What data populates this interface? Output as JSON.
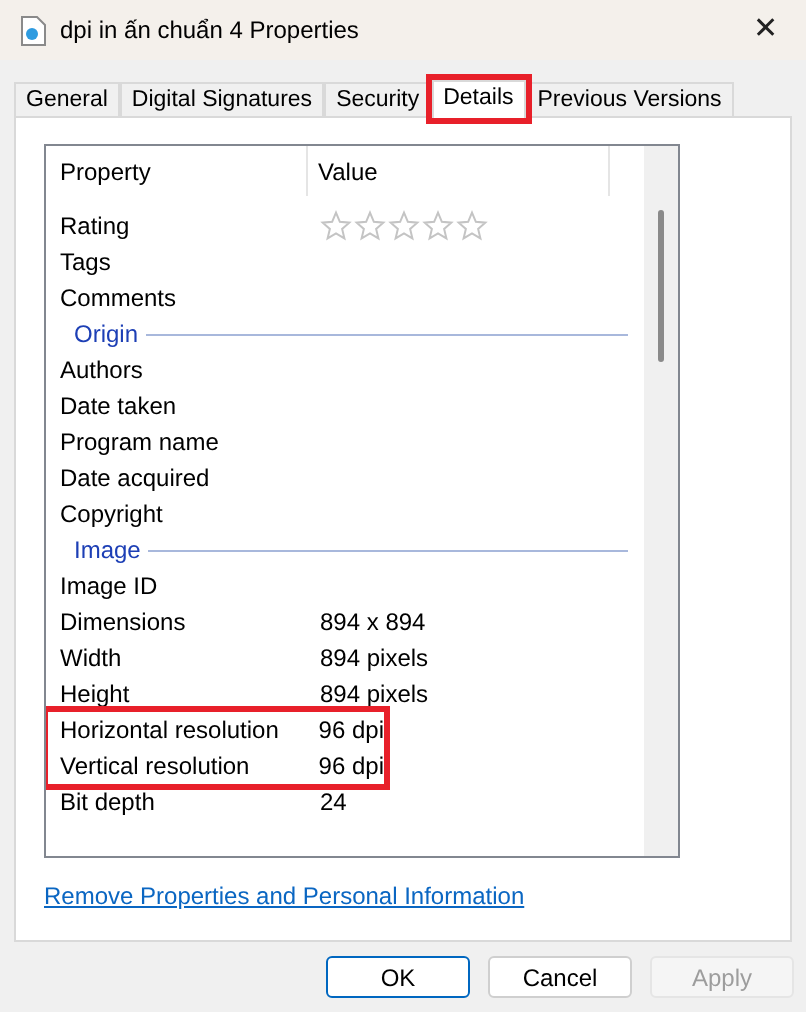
{
  "window": {
    "title": "dpi in ấn chuẩn 4 Properties",
    "close": "✕"
  },
  "tabs": [
    {
      "label": "General",
      "selected": false,
      "highlighted": false
    },
    {
      "label": "Digital Signatures",
      "selected": false,
      "highlighted": false
    },
    {
      "label": "Security",
      "selected": false,
      "highlighted": false
    },
    {
      "label": "Details",
      "selected": true,
      "highlighted": true
    },
    {
      "label": "Previous Versions",
      "selected": false,
      "highlighted": false
    }
  ],
  "table": {
    "columns": [
      "Property",
      "Value"
    ],
    "rows": [
      {
        "kind": "rating",
        "name": "Rating",
        "stars": 0,
        "highlighted": false
      },
      {
        "kind": "property",
        "name": "Tags",
        "highlighted": false
      },
      {
        "kind": "property",
        "name": "Comments",
        "highlighted": false
      },
      {
        "kind": "group",
        "name": "Origin",
        "highlighted": false
      },
      {
        "kind": "property",
        "name": "Authors",
        "highlighted": false
      },
      {
        "kind": "property",
        "name": "Date taken",
        "highlighted": false
      },
      {
        "kind": "property",
        "name": "Program name",
        "highlighted": false
      },
      {
        "kind": "property",
        "name": "Date acquired",
        "highlighted": false
      },
      {
        "kind": "property",
        "name": "Copyright",
        "highlighted": false
      },
      {
        "kind": "group",
        "name": "Image",
        "highlighted": false
      },
      {
        "kind": "property",
        "name": "Image ID",
        "highlighted": false
      },
      {
        "kind": "property",
        "name": "Dimensions",
        "value": "894 x 894",
        "highlighted": false
      },
      {
        "kind": "property",
        "name": "Width",
        "value": "894 pixels",
        "highlighted": false
      },
      {
        "kind": "property",
        "name": "Height",
        "value": "894 pixels",
        "highlighted": false
      },
      {
        "kind": "property",
        "name": "Horizontal resolution",
        "value": "96 dpi",
        "highlighted": true
      },
      {
        "kind": "property",
        "name": "Vertical resolution",
        "value": "96 dpi",
        "highlighted": true
      },
      {
        "kind": "property",
        "name": "Bit depth",
        "value": "24",
        "highlighted": false
      }
    ]
  },
  "link": "Remove Properties and Personal Information",
  "buttons": [
    {
      "label": "OK",
      "default": true,
      "disabled": false
    },
    {
      "label": "Cancel",
      "default": false,
      "disabled": false
    },
    {
      "label": "Apply",
      "default": false,
      "disabled": true
    }
  ]
}
